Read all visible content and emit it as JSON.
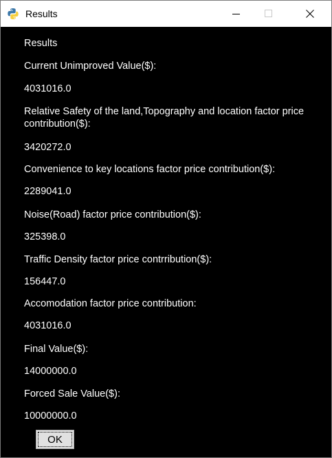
{
  "window": {
    "title": "Results"
  },
  "results": {
    "heading": "Results",
    "current_unimproved_label": "Current Unimproved Value($):",
    "current_unimproved_value": "4031016.0",
    "safety_label": "Relative Safety of the land,Topography and location factor price contribution($):",
    "safety_value": "3420272.0",
    "convenience_label": "Convenience to key locations factor price contribution($):",
    "convenience_value": "2289041.0",
    "noise_label": "Noise(Road) factor price contribution($):",
    "noise_value": "325398.0",
    "traffic_label": "Traffic Density factor price contrribution($):",
    "traffic_value": "156447.0",
    "accommodation_label": "Accomodation factor price contribution:",
    "accommodation_value": "4031016.0",
    "final_label": "Final Value($):",
    "final_value": "14000000.0",
    "forced_sale_label": "Forced Sale Value($):",
    "forced_sale_value": "10000000.0"
  },
  "actions": {
    "ok_label": "OK"
  },
  "colors": {
    "background": "#000000",
    "text": "#ffffff",
    "titlebar": "#ffffff"
  }
}
